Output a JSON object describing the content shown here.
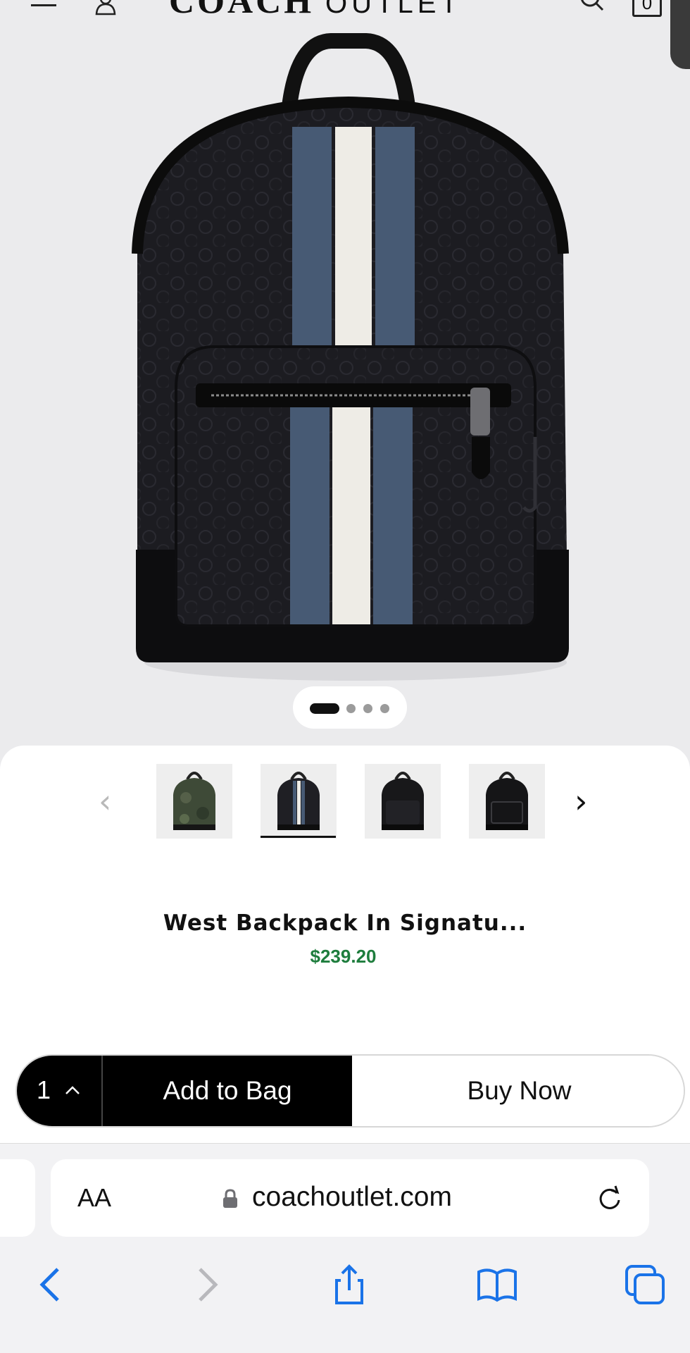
{
  "header": {
    "brand_strong": "COACH",
    "brand_light": "OUTLET",
    "cart_count": "0"
  },
  "carousel": {
    "image_count": 4,
    "active_index": 0
  },
  "thumbnails": [
    {
      "color": "#3e4a37",
      "selected": false
    },
    {
      "color": "#1f1f24",
      "selected": true
    },
    {
      "color": "#18181a",
      "selected": false
    },
    {
      "color": "#151517",
      "selected": false
    }
  ],
  "product": {
    "title": "West Backpack In Signatu...",
    "price": "$239.20",
    "price_color": "#1e7d3d"
  },
  "purchase": {
    "quantity": "1",
    "add_label": "Add to Bag",
    "buy_label": "Buy Now"
  },
  "browser": {
    "text_size_label": "AA",
    "url": "coachoutlet.com",
    "accent_color": "#1a73e8"
  }
}
